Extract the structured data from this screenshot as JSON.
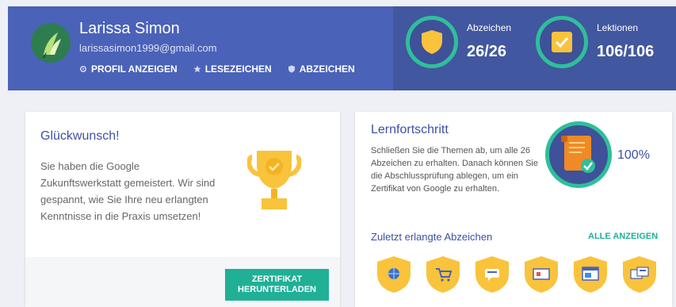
{
  "header": {
    "user_name": "Larissa Simon",
    "email": "larissasimon1999@gmail.com",
    "nav": [
      {
        "label": "PROFIL ANZEIGEN",
        "icon": "gear-icon"
      },
      {
        "label": "LESEZEICHEN",
        "icon": "star-icon"
      },
      {
        "label": "ABZEICHEN",
        "icon": "shield-icon"
      }
    ],
    "stats": [
      {
        "label": "Abzeichen",
        "value": "26/26",
        "icon": "badge-shield-icon"
      },
      {
        "label": "Lektionen",
        "value": "106/106",
        "icon": "lessons-check-icon"
      }
    ]
  },
  "congrats": {
    "title": "Glückwunsch!",
    "text": "Sie haben die Google Zukunftswerkstatt gemeistert. Wir sind gespannt, wie Sie Ihre neu erlangten Kenntnisse in die Praxis umsetzen!",
    "button_line1": "ZERTIFIKAT",
    "button_line2": "HERUNTERLADEN"
  },
  "progress": {
    "title": "Lernfortschritt",
    "text": "Schließen Sie die Themen ab, um alle 26 Abzeichen zu erhalten. Danach können Sie die Abschlussprüfung ablegen, um ein Zertifikat von Google zu erhalten.",
    "percent": "100%",
    "recent_title": "Zuletzt erlangte Abzeichen",
    "show_all": "ALLE ANZEIGEN",
    "badges": [
      "globe-badge-icon",
      "cart-badge-icon",
      "chat-badge-icon",
      "screen-badge-icon",
      "browser-badge-icon",
      "cards-badge-icon"
    ]
  },
  "colors": {
    "header": "#4a62b8",
    "header_dark": "#41579f",
    "accent": "#1fb096",
    "ring": "#2fbf9a",
    "title": "#3e50a6",
    "gold": "#f9c33c"
  }
}
